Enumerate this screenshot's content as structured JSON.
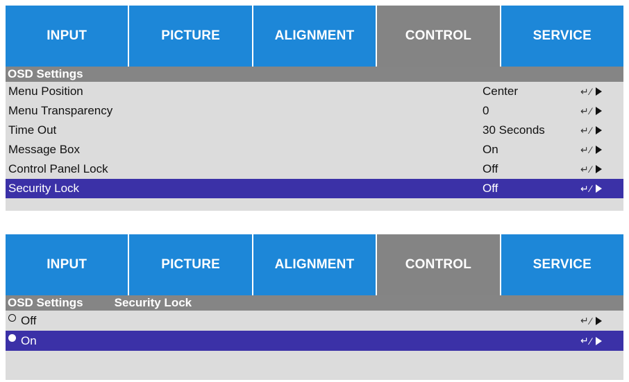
{
  "tabs": [
    "INPUT",
    "PICTURE",
    "ALIGNMENT",
    "CONTROL",
    "SERVICE"
  ],
  "active_tab": "CONTROL",
  "panel1": {
    "header": "OSD Settings",
    "rows": [
      {
        "label": "Menu Position",
        "value": "Center"
      },
      {
        "label": "Menu Transparency",
        "value": "0"
      },
      {
        "label": "Time Out",
        "value": "30 Seconds"
      },
      {
        "label": "Message Box",
        "value": "On"
      },
      {
        "label": "Control Panel Lock",
        "value": "Off"
      },
      {
        "label": "Security Lock",
        "value": "Off",
        "selected": true
      }
    ]
  },
  "panel2": {
    "header": "OSD Settings",
    "subheader": "Security Lock",
    "options": [
      {
        "label": "Off",
        "selected": false
      },
      {
        "label": "On",
        "selected": true
      }
    ]
  },
  "icons": {
    "enter": "enter-icon",
    "slash": "slash-separator",
    "arrow": "right-arrow-icon"
  },
  "colors": {
    "tab_blue": "#1d87d8",
    "tab_active_gray": "#848484",
    "header_gray": "#858585",
    "row_bg": "#dcdcdc",
    "selected_row": "#3b31a7"
  }
}
